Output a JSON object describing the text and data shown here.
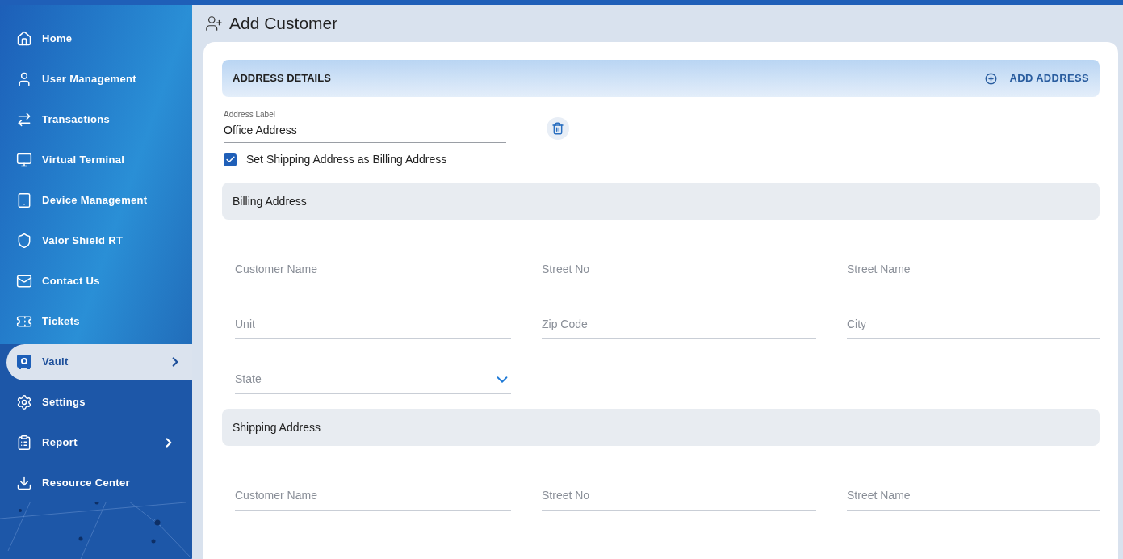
{
  "sidebar": {
    "items": [
      {
        "label": "Home",
        "selected": false,
        "has_submenu": false
      },
      {
        "label": "User Management",
        "selected": false,
        "has_submenu": false
      },
      {
        "label": "Transactions",
        "selected": false,
        "has_submenu": false
      },
      {
        "label": "Virtual Terminal",
        "selected": false,
        "has_submenu": false
      },
      {
        "label": "Device Management",
        "selected": false,
        "has_submenu": false
      },
      {
        "label": "Valor Shield RT",
        "selected": false,
        "has_submenu": false
      },
      {
        "label": "Contact Us",
        "selected": false,
        "has_submenu": false
      },
      {
        "label": "Tickets",
        "selected": false,
        "has_submenu": false
      },
      {
        "label": "Vault",
        "selected": true,
        "has_submenu": true
      },
      {
        "label": "Settings",
        "selected": false,
        "has_submenu": false
      },
      {
        "label": "Report",
        "selected": false,
        "has_submenu": true
      },
      {
        "label": "Resource Center",
        "selected": false,
        "has_submenu": false
      }
    ]
  },
  "page_title": "Add Customer",
  "address_details": {
    "title": "ADDRESS DETAILS",
    "add_button": "ADD ADDRESS",
    "address_label": {
      "label": "Address Label",
      "value": "Office Address"
    },
    "same_billing": {
      "label": "Set Shipping Address as Billing Address",
      "checked": true
    },
    "sections": [
      {
        "title": "Billing Address",
        "fields": [
          {
            "placeholder": "Customer Name",
            "kind": "text"
          },
          {
            "placeholder": "Street No",
            "kind": "text"
          },
          {
            "placeholder": "Street Name",
            "kind": "text"
          },
          {
            "placeholder": "Unit",
            "kind": "text"
          },
          {
            "placeholder": "Zip Code",
            "kind": "text"
          },
          {
            "placeholder": "City",
            "kind": "text"
          },
          {
            "placeholder": "State",
            "kind": "select"
          }
        ]
      },
      {
        "title": "Shipping Address",
        "fields": [
          {
            "placeholder": "Customer Name",
            "kind": "text"
          },
          {
            "placeholder": "Street No",
            "kind": "text"
          },
          {
            "placeholder": "Street Name",
            "kind": "text"
          }
        ]
      }
    ]
  }
}
